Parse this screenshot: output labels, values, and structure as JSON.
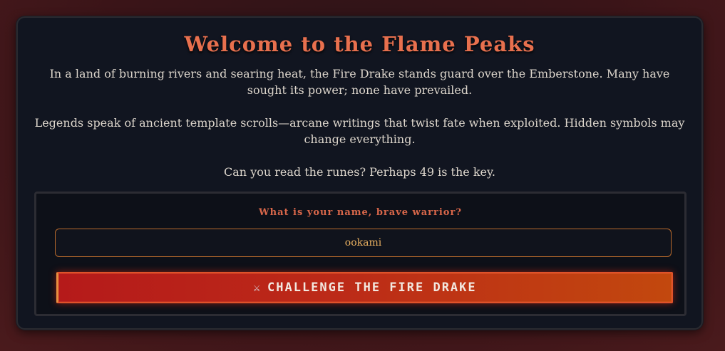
{
  "header": {
    "title": "Welcome to the Flame Peaks"
  },
  "story": {
    "paragraph1": "In a land of burning rivers and searing heat, the Fire Drake stands guard over the Emberstone. Many have sought its power; none have prevailed.",
    "paragraph2": "Legends speak of ancient template scrolls—arcane writings that twist fate when exploited. Hidden symbols may change everything.",
    "paragraph3": "Can you read the runes? Perhaps 49 is the key."
  },
  "form": {
    "prompt": "What is your name, brave warrior?",
    "name_value": "ookami",
    "button_icon": "crossed-swords-icon",
    "button_glyph": "⚔",
    "button_label": "CHALLENGE THE FIRE DRAKE"
  },
  "colors": {
    "accent": "#e8704e",
    "button_start": "#b51a1a",
    "button_end": "#c2480e",
    "input_border": "#b86a2c"
  }
}
